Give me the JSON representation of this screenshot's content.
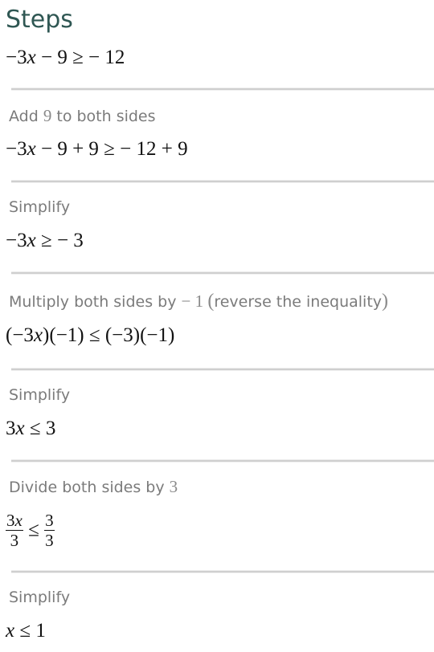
{
  "header": {
    "title": "Steps"
  },
  "colors": {
    "title": "#2f5753",
    "description": "#7b7b7b",
    "math": "#111111",
    "separator": "#cfcfcf"
  },
  "initial": {
    "expression": "−3x − 9 ≥  − 12",
    "parts": {
      "lhs_coef": "−3",
      "var": "x",
      "lhs_rest": " − 9 ≥ ",
      "rhs": " − 12"
    }
  },
  "steps": [
    {
      "description": "Add 9 to both sides",
      "desc_parts": {
        "before": "Add ",
        "num": "9",
        "after": " to both sides"
      },
      "expression": "−3x − 9 + 9 ≥  − 12 + 9",
      "parts": {
        "lhs_coef": "−3",
        "var": "x",
        "lhs_rest": " − 9 + 9 ≥ ",
        "rhs": " − 12 + 9"
      }
    },
    {
      "description": "Simplify",
      "expression": "−3x ≥  − 3",
      "parts": {
        "lhs_coef": "−3",
        "var": "x",
        "lhs_rest": " ≥ ",
        "rhs": " − 3"
      }
    },
    {
      "description": "Multiply both sides by  − 1 (reverse the inequality)",
      "desc_parts": {
        "before": "Multiply both sides by ",
        "num": " − 1 ",
        "paren_open": "(",
        "inner": "reverse the inequality",
        "paren_close": ")"
      },
      "expression": "(−3x)(−1) ≤ (−3)(−1)",
      "parts": {
        "open": "(−3",
        "var": "x",
        "rest": ")(−1) ≤ (−3)(−1)"
      }
    },
    {
      "description": "Simplify",
      "expression": "3x ≤  3",
      "parts": {
        "lhs_coef": "3",
        "var": "x",
        "lhs_rest": " ≤ ",
        "rhs": " 3"
      }
    },
    {
      "description": "Divide both sides by 3",
      "desc_parts": {
        "before": "Divide both sides by ",
        "num": "3"
      },
      "expression": "3x/3 ≤ 3/3",
      "parts": {
        "lhs_num_coef": "3",
        "var": "x",
        "lhs_den": "3",
        "rel": "≤",
        "rhs_num": "3",
        "rhs_den": "3"
      }
    },
    {
      "description": "Simplify",
      "expression": "x ≤  1",
      "parts": {
        "var": "x",
        "rest": " ≤  1"
      }
    }
  ]
}
